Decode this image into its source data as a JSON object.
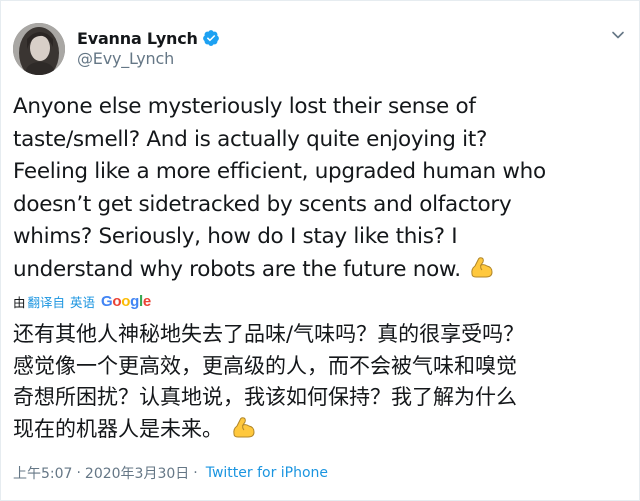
{
  "author": {
    "display_name": "Evanna Lynch",
    "handle": "@Evy_Lynch",
    "verified": true
  },
  "icons": {
    "verified": "verified-badge-icon",
    "menu": "chevron-down-icon",
    "emoji": "flexed-biceps-emoji"
  },
  "tweet": {
    "lines": [
      "Anyone else mysteriously lost their sense of",
      "taste/smell? And is actually quite enjoying it?",
      "Feeling like a more efficient, upgraded human who",
      "doesn’t get sidetracked by scents and olfactory",
      "whims? Seriously, how do I stay like this? I",
      "understand why robots are the future now."
    ]
  },
  "translation_bar": {
    "translated_by": "由",
    "link_label": "翻译自",
    "language": "英语",
    "provider_parts": [
      "G",
      "o",
      "o",
      "g",
      "l",
      "e"
    ]
  },
  "translation": {
    "lines": [
      "还有其他人神秘地失去了品味/气味吗？真的很享受吗？",
      "感觉像一个更高效，更高级的人，而不会被气味和嗅觉",
      "奇想所困扰？认真地说，我该如何保持？我了解为什么",
      "现在的机器人是未来。"
    ]
  },
  "meta": {
    "time": "上午5:07",
    "separator": "·",
    "date": "2020年3月30日",
    "source": "Twitter for iPhone"
  },
  "colors": {
    "text": "#14171a",
    "secondary": "#657786",
    "link": "#1b95e0",
    "verified": "#1da1f2",
    "emoji": "#ffc83d"
  }
}
